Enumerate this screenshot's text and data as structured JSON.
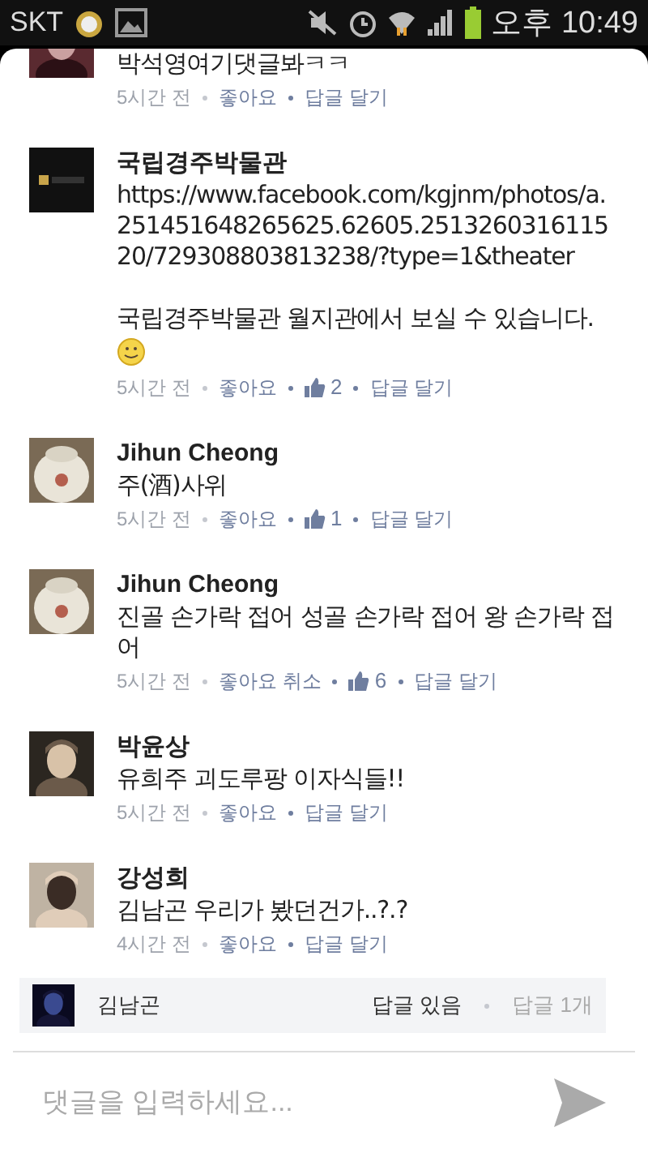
{
  "status_bar": {
    "carrier": "SKT",
    "time": "오후 10:49"
  },
  "comments": [
    {
      "text": "박석영여기댓글봐ㅋㅋ",
      "time": "5시간 전",
      "like_label": "좋아요",
      "reply_label": "답글 달기"
    },
    {
      "author": "국립경주박물관",
      "text": "https://www.facebook.com/kgjnm/photos/a.251451648265625.62605.251326031611520/729308803813238/?type=1&theater\n\n국립경주박물관 월지관에서 보실 수 있습니다.",
      "smiley": true,
      "time": "5시간 전",
      "like_label": "좋아요",
      "likes": "2",
      "reply_label": "답글 달기"
    },
    {
      "author": "Jihun Cheong",
      "text": "주(酒)사위",
      "time": "5시간 전",
      "like_label": "좋아요",
      "likes": "1",
      "reply_label": "답글 달기"
    },
    {
      "author": "Jihun Cheong",
      "text": "진골 손가락 접어 성골 손가락 접어 왕 손가락 접어",
      "time": "5시간 전",
      "like_label": "좋아요 취소",
      "likes": "6",
      "reply_label": "답글 달기"
    },
    {
      "author": "박윤상",
      "text": "유희주 괴도루팡 이자식들!!",
      "time": "5시간 전",
      "like_label": "좋아요",
      "reply_label": "답글 달기"
    },
    {
      "author": "강성희",
      "text": "김남곤 우리가 봤던건가..?.?",
      "time": "4시간 전",
      "like_label": "좋아요",
      "reply_label": "답글 달기",
      "reply_preview": {
        "author": "김남곤",
        "status": "답글 있음",
        "count": "답글 1개"
      }
    }
  ],
  "composer": {
    "placeholder": "댓글을 입력하세요..."
  }
}
